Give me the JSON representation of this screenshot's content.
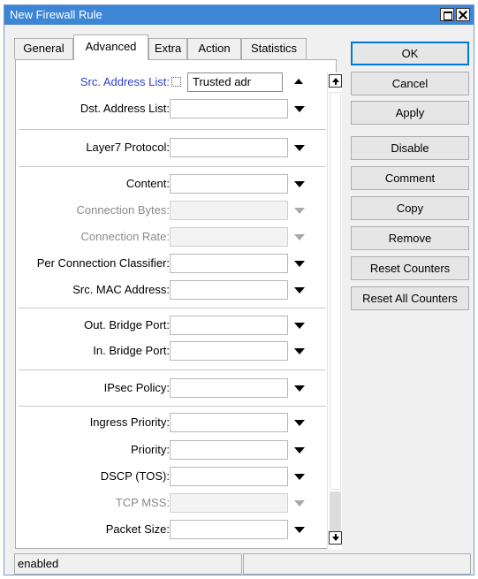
{
  "window": {
    "title": "New Firewall Rule"
  },
  "tabs": [
    {
      "label": "General",
      "active": false
    },
    {
      "label": "Advanced",
      "active": true
    },
    {
      "label": "Extra",
      "active": false
    },
    {
      "label": "Action",
      "active": false
    },
    {
      "label": "Statistics",
      "active": false
    }
  ],
  "fields": {
    "src_address_list": {
      "label": "Src. Address List:",
      "value": "Trusted adr",
      "negate_checked": false
    },
    "dst_address_list": {
      "label": "Dst. Address List:",
      "value": ""
    },
    "layer7_protocol": {
      "label": "Layer7 Protocol:",
      "value": ""
    },
    "content": {
      "label": "Content:",
      "value": ""
    },
    "connection_bytes": {
      "label": "Connection Bytes:",
      "value": "",
      "disabled": true
    },
    "connection_rate": {
      "label": "Connection Rate:",
      "value": "",
      "disabled": true
    },
    "per_connection_classifier": {
      "label": "Per Connection Classifier:",
      "value": ""
    },
    "src_mac_address": {
      "label": "Src. MAC Address:",
      "value": ""
    },
    "out_bridge_port": {
      "label": "Out. Bridge Port:",
      "value": ""
    },
    "in_bridge_port": {
      "label": "In. Bridge Port:",
      "value": ""
    },
    "ipsec_policy": {
      "label": "IPsec Policy:",
      "value": ""
    },
    "ingress_priority": {
      "label": "Ingress Priority:",
      "value": ""
    },
    "priority": {
      "label": "Priority:",
      "value": ""
    },
    "dscp_tos": {
      "label": "DSCP (TOS):",
      "value": ""
    },
    "tcp_mss": {
      "label": "TCP MSS:",
      "value": "",
      "disabled": true
    },
    "packet_size": {
      "label": "Packet Size:",
      "value": ""
    }
  },
  "buttons": {
    "ok": "OK",
    "cancel": "Cancel",
    "apply": "Apply",
    "disable": "Disable",
    "comment": "Comment",
    "copy": "Copy",
    "remove": "Remove",
    "reset_counters": "Reset Counters",
    "reset_all_counters": "Reset All Counters"
  },
  "status": {
    "left": "enabled",
    "right": ""
  },
  "colors": {
    "titlebar": "#3d86d6",
    "link_label": "#2a40c8",
    "disabled_label": "#8a8a8a",
    "ok_border": "#0078d7"
  }
}
